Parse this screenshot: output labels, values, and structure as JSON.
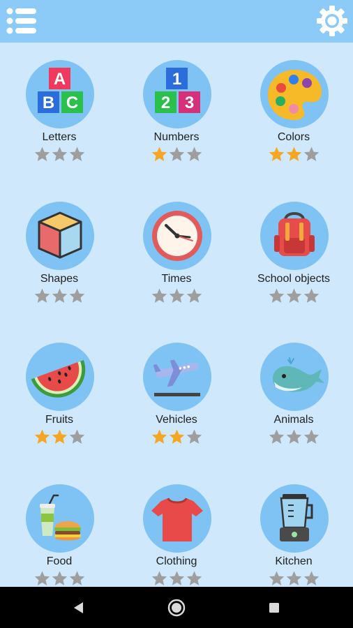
{
  "header": {
    "menu_icon": "hamburger-menu-icon",
    "settings_icon": "gear-icon",
    "background_color": "#8ccbf7"
  },
  "colors": {
    "page_background": "#cfe8fb",
    "circle": "#7ec3f4",
    "star_filled": "#f5a623",
    "star_empty": "#9e9e9e"
  },
  "categories": [
    {
      "label": "Letters",
      "icon": "abc-blocks-icon",
      "stars_filled": 0,
      "stars_total": 3
    },
    {
      "label": "Numbers",
      "icon": "number-blocks-icon",
      "stars_filled": 1,
      "stars_total": 3
    },
    {
      "label": "Colors",
      "icon": "paint-palette-icon",
      "stars_filled": 2,
      "stars_total": 3
    },
    {
      "label": "Shapes",
      "icon": "cube-icon",
      "stars_filled": 0,
      "stars_total": 3
    },
    {
      "label": "Times",
      "icon": "clock-icon",
      "stars_filled": 0,
      "stars_total": 3
    },
    {
      "label": "School objects",
      "icon": "backpack-icon",
      "stars_filled": 0,
      "stars_total": 3
    },
    {
      "label": "Fruits",
      "icon": "watermelon-icon",
      "stars_filled": 2,
      "stars_total": 3
    },
    {
      "label": "Vehicles",
      "icon": "airplane-icon",
      "stars_filled": 2,
      "stars_total": 3
    },
    {
      "label": "Animals",
      "icon": "whale-icon",
      "stars_filled": 0,
      "stars_total": 3
    },
    {
      "label": "Food",
      "icon": "burger-drink-icon",
      "stars_filled": 0,
      "stars_total": 3
    },
    {
      "label": "Clothing",
      "icon": "tshirt-icon",
      "stars_filled": 0,
      "stars_total": 3
    },
    {
      "label": "Kitchen",
      "icon": "blender-icon",
      "stars_filled": 0,
      "stars_total": 3
    }
  ],
  "system_nav": {
    "back_icon": "back-triangle-icon",
    "home_icon": "home-circle-icon",
    "recents_icon": "recents-square-icon"
  }
}
